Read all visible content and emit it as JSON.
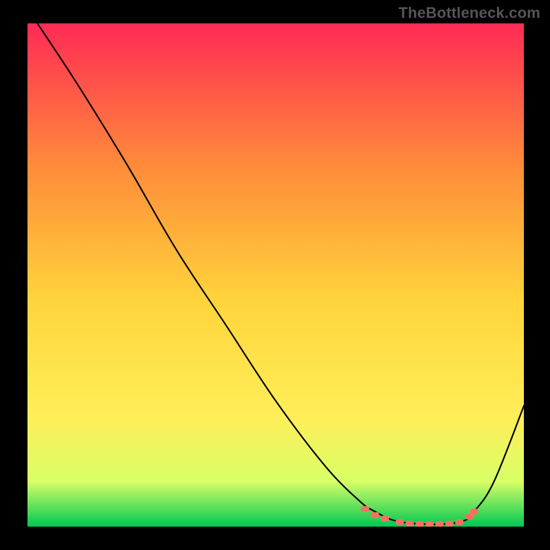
{
  "watermark": "TheBottleneck.com",
  "chart_data": {
    "type": "line",
    "title": "",
    "xlabel": "",
    "ylabel": "",
    "xlim": [
      0,
      100
    ],
    "ylim": [
      0,
      100
    ],
    "grid": false,
    "legend": false,
    "background_gradient": {
      "top": "#ff2a55",
      "mid_top": "#ff8a3a",
      "mid": "#ffd43b",
      "mid_low": "#ffee58",
      "low_band": "#d9ff66",
      "bottom": "#00c853"
    },
    "series": [
      {
        "name": "bottleneck-curve",
        "color": "#000000",
        "x": [
          2,
          10,
          20,
          30,
          40,
          50,
          60,
          67,
          70,
          73,
          76,
          80,
          84,
          88,
          90,
          94,
          100
        ],
        "y": [
          100,
          88,
          72,
          55,
          40,
          25,
          12,
          5,
          3,
          1.5,
          0.8,
          0.5,
          0.5,
          1.2,
          3,
          9,
          24
        ],
        "markers": false
      },
      {
        "name": "optimal-zone-markers",
        "color": "#ff6f61",
        "x": [
          68,
          70,
          72,
          75,
          77,
          79,
          81,
          83,
          85,
          87,
          89,
          90
        ],
        "y": [
          3.5,
          2.3,
          1.6,
          0.9,
          0.6,
          0.5,
          0.5,
          0.5,
          0.6,
          0.9,
          2.0,
          3.0
        ],
        "markers": true,
        "marker_shape": "rect"
      }
    ]
  }
}
